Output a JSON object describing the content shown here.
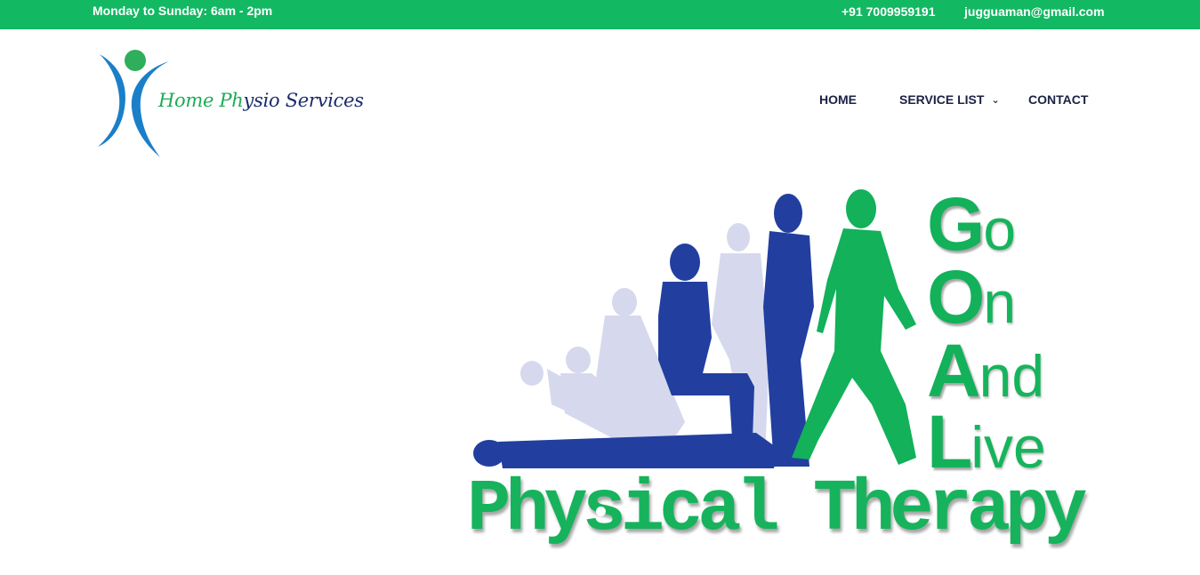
{
  "topbar": {
    "hours": "Monday to Sunday: 6am - 2pm",
    "phone": "+91 7009959191",
    "email": "jugguaman@gmail.com",
    "bg_color": "#13b863"
  },
  "brand": {
    "name_part1": "Home Ph",
    "name_part2": "ysio Services",
    "logo_icon": "person-figure-icon"
  },
  "nav": {
    "home": "HOME",
    "services": "SERVICE LIST",
    "contact": "CONTACT",
    "dropdown_icon": "chevron-down-icon"
  },
  "hero": {
    "goal_rows": [
      {
        "big": "G",
        "small": "o"
      },
      {
        "big": "O",
        "small": "n"
      },
      {
        "big": "A",
        "small": "nd"
      },
      {
        "big": "L",
        "small": "ive"
      }
    ],
    "title": "Physical Therapy",
    "accent_green": "#16b35c",
    "figure_blue": "#223f9f"
  }
}
